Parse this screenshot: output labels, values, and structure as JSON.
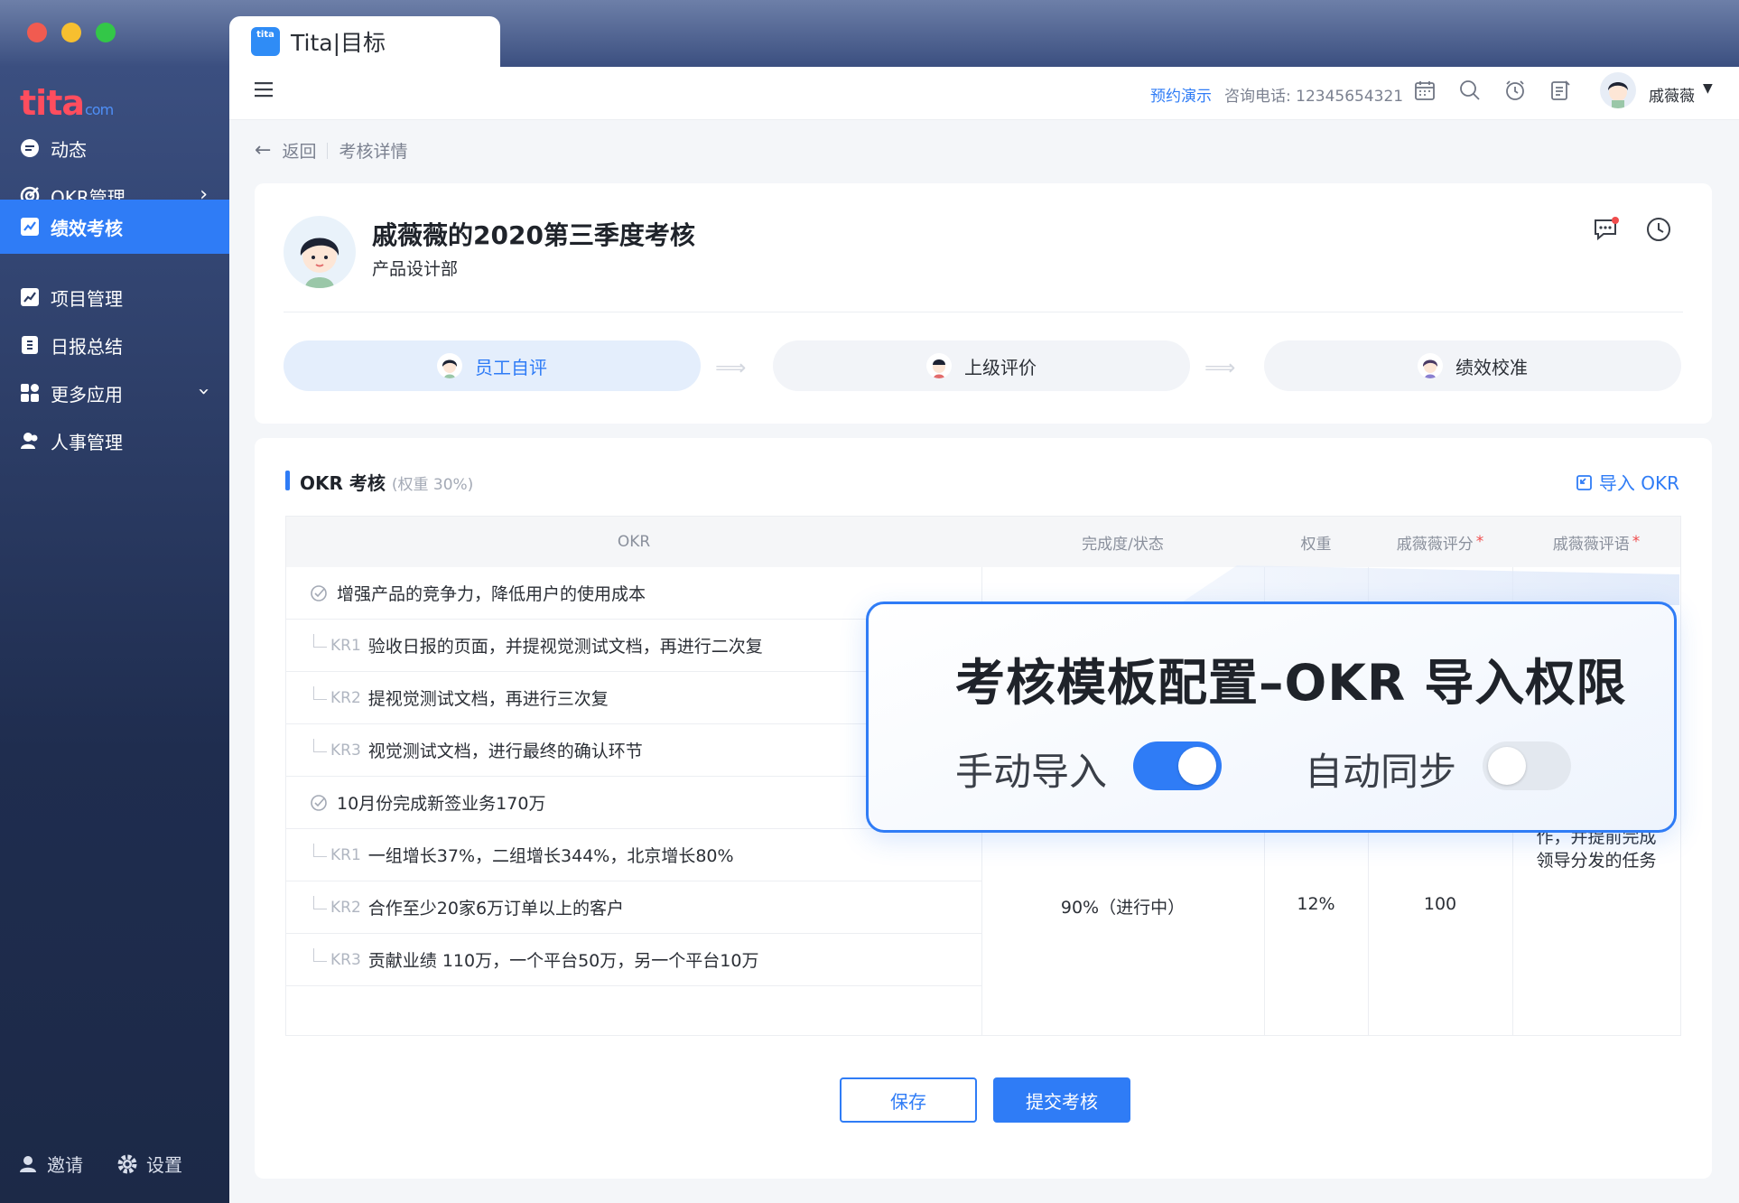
{
  "window": {
    "tab_title": "Tita|目标",
    "tab_icon_text": "tita"
  },
  "sidebar": {
    "logo": "tita",
    "logo_suffix": "com",
    "items": [
      {
        "label": "动态",
        "icon": "chat-bubble-icon"
      },
      {
        "label": "OKR管理",
        "icon": "target-icon"
      },
      {
        "label": "绩效考核",
        "icon": "chart-icon"
      },
      {
        "label": "项目管理",
        "icon": "trend-icon"
      },
      {
        "label": "日报总结",
        "icon": "daily-report-icon"
      },
      {
        "label": "更多应用",
        "icon": "apps-grid-icon"
      },
      {
        "label": "人事管理",
        "icon": "people-icon"
      }
    ],
    "invite": "邀请",
    "settings": "设置"
  },
  "header": {
    "demo_link": "预约演示",
    "hotline": "咨询电话: 12345654321",
    "user_name": "戚薇薇"
  },
  "breadcrumb": {
    "back": "返回",
    "current": "考核详情"
  },
  "review": {
    "title": "戚薇薇的2020第三季度考核",
    "department": "产品设计部",
    "steps": [
      "员工自评",
      "上级评价",
      "绩效校准"
    ]
  },
  "okr_section": {
    "title": "OKR 考核",
    "weight": "(权重 30%)",
    "import_label": "导入 OKR",
    "columns": [
      "OKR",
      "完成度/状态",
      "权重",
      "戚薇薇评分",
      "戚薇薇评语"
    ],
    "rows": [
      {
        "type": "objective",
        "text": "增强产品的竞争力，降低用户的使用成本"
      },
      {
        "type": "kr",
        "tag": "KR1",
        "text": "验收日报的页面，并提视觉测试文档，再进行二次复"
      },
      {
        "type": "kr",
        "tag": "KR2",
        "text": "提视觉测试文档，再进行三次复"
      },
      {
        "type": "kr",
        "tag": "KR3",
        "text": "视觉测试文档，进行最终的确认环节"
      },
      {
        "type": "objective",
        "text": "10月份完成新签业务170万"
      },
      {
        "type": "kr",
        "tag": "KR1",
        "text": "一组增长37%，二组增长344%，北京增长80%"
      },
      {
        "type": "kr",
        "tag": "KR2",
        "text": "合作至少20家6万订单以上的客户"
      },
      {
        "type": "kr",
        "tag": "KR3",
        "text": "贡献业绩 110万，一个平台50万，另一个平台10万"
      }
    ],
    "obj2": {
      "progress": "90%（进行中）",
      "weight": "12%",
      "score": "100",
      "comment": "积极配合前端工作，并提前完成领导分发的任务"
    }
  },
  "buttons": {
    "save": "保存",
    "submit": "提交考核"
  },
  "callout": {
    "title": "考核模板配置–OKR 导入权限",
    "manual_import": "手动导入",
    "manual_import_on": true,
    "auto_sync": "自动同步",
    "auto_sync_on": false
  },
  "colors": {
    "accent": "#2f7cf6",
    "sidebar": "#1f2d4f",
    "required_star": "#f04c4c"
  }
}
